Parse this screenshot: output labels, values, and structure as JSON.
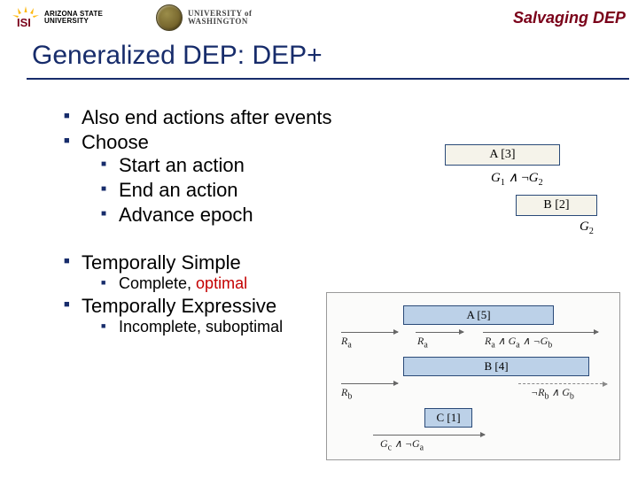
{
  "header": {
    "asu_lines": [
      "ARIZONA STATE",
      "UNIVERSITY"
    ],
    "uw_line1": "UNIVERSITY of",
    "uw_line2": "WASHINGTON",
    "salvaging": "Salvaging DEP"
  },
  "title": "Generalized DEP: DEP+",
  "bullets1": {
    "i0": "Also end actions after events",
    "i1": "Choose",
    "sub": {
      "s0": "Start an action",
      "s1": "End an action",
      "s2": "Advance epoch"
    }
  },
  "bullets2": {
    "i0": "Temporally Simple",
    "i0_sub": "Complete, ",
    "i0_sub_em": "optimal",
    "i1": "Temporally Expressive",
    "i1_sub": "Incomplete, suboptimal"
  },
  "boxA": "A [3]",
  "boxB": "B [2]",
  "formulaA": "G₁ ∧ ¬G₂",
  "formulaB": "G₂",
  "diagram": {
    "A": "A [5]",
    "B": "B [4]",
    "C": "C [1]",
    "Ra": "Rₐ",
    "Rb": "R_b",
    "Gc": "G_c ∧ ¬G_a",
    "RaGa": "Rₐ ∧ Gₐ ∧ ¬G_b",
    "RbGb": "¬R_b ∧ G_b"
  }
}
